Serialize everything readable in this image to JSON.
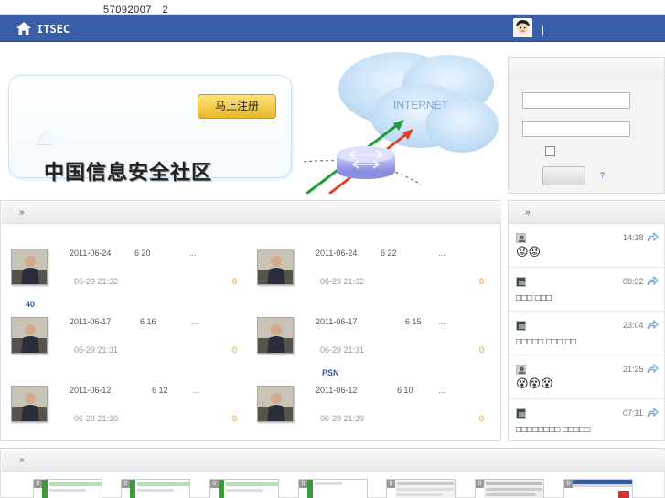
{
  "topbar": {
    "text": "57092007　2"
  },
  "nav": {
    "brand": "ITSEC",
    "separator": "|"
  },
  "banner": {
    "register_label": "马上注册",
    "slogan": "中国信息安全社区",
    "cloud_label": "INTERNET"
  },
  "login": {
    "help": "?"
  },
  "news": {
    "header": "»",
    "items": [
      {
        "date": "2011-06-24",
        "num": "6 20",
        "dots": "...",
        "time": "06-29 21:32",
        "count": "0"
      },
      {
        "date": "2011-06-24",
        "num": "6 22",
        "dots": "...",
        "time": "06-29 21:32",
        "count": "0"
      },
      {
        "date": "2011-06-17",
        "num": "6 16",
        "dots": "...",
        "time": "06-29 21:31",
        "count": "0"
      },
      {
        "date": "2011-06-17",
        "num": "6 15",
        "dots": "...",
        "time": "06-29 21:31",
        "count": "0"
      },
      {
        "date": "2011-06-12",
        "num": "6 12",
        "dots": "...",
        "time": "06-29 21:30",
        "count": "0"
      },
      {
        "date": "2011-06-12",
        "num": "6 10",
        "dots": "...",
        "time": "06-29 21:29",
        "count": "0"
      }
    ],
    "label_40": "40",
    "label_psn": "PSN"
  },
  "feed": {
    "header": "»",
    "items": [
      {
        "time": "14:18",
        "text": "😡😡"
      },
      {
        "time": "08:32",
        "text": "□□□ □□□"
      },
      {
        "time": "23:04",
        "text": "□□□□□ □□□ □□"
      },
      {
        "time": "21:25",
        "text": "😵😵😵"
      },
      {
        "time": "07:11",
        "text": "□□□□□□□□ □□□□□"
      }
    ]
  },
  "bottom": {
    "header": "»",
    "shots": [
      "0",
      "0",
      "0",
      "0",
      "0",
      "0",
      "0"
    ]
  },
  "colors": {
    "nav": "#3a5ea5",
    "accent": "#e8900b",
    "link": "#2c5aa0"
  }
}
